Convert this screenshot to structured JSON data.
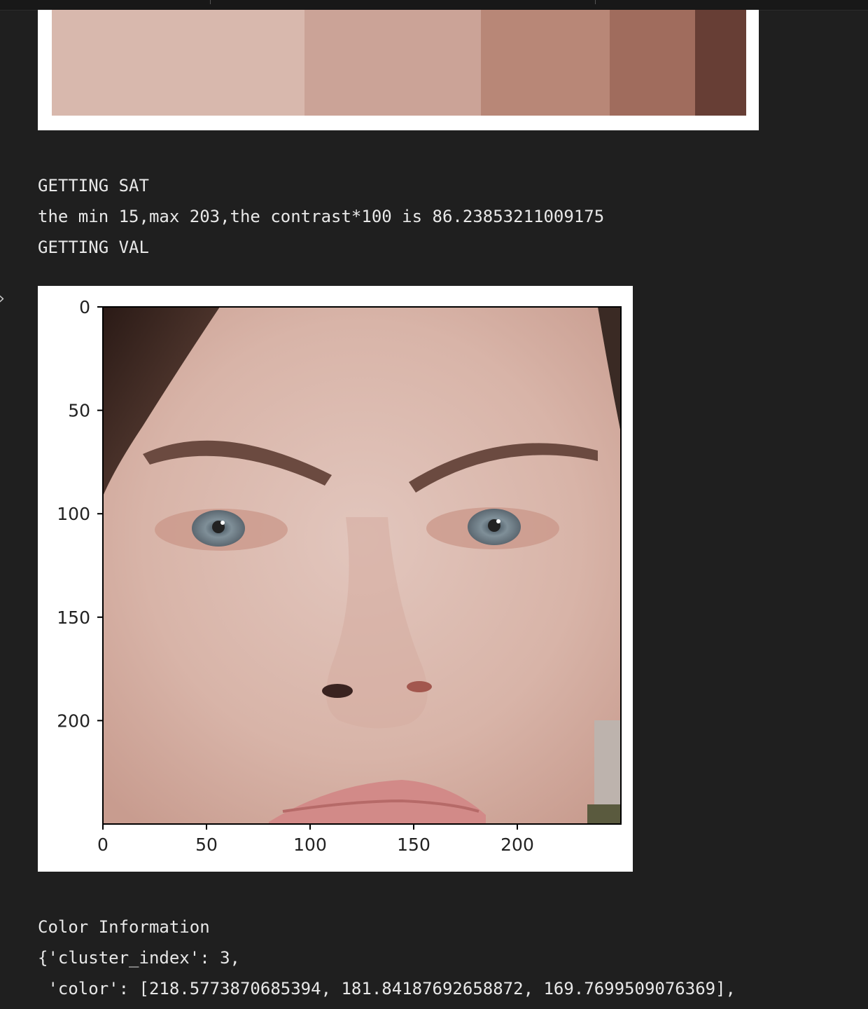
{
  "output": {
    "line_sat_header": "GETTING SAT",
    "line_contrast": "the min 15,max 203,the contrast*100 is 86.23853211009175",
    "line_val_header": "GETTING VAL",
    "color_info_header": "Color Information",
    "color_info_line1": "{'cluster_index': 3,",
    "color_info_line2": " 'color': [218.5773870685394, 181.84187692658872, 169.7699509076369],"
  },
  "palette": {
    "swatches": [
      {
        "color": "#d8b8ad",
        "fraction": 0.364
      },
      {
        "color": "#cba397",
        "fraction": 0.254
      },
      {
        "color": "#b88777",
        "fraction": 0.185
      },
      {
        "color": "#a06c5d",
        "fraction": 0.123
      },
      {
        "color": "#673e35",
        "fraction": 0.074
      }
    ]
  },
  "image_plot": {
    "x_ticks": [
      "0",
      "50",
      "100",
      "150",
      "200"
    ],
    "y_ticks": [
      "0",
      "50",
      "100",
      "150",
      "200"
    ],
    "x_tick_values": [
      0,
      50,
      100,
      150,
      200
    ],
    "y_tick_values": [
      0,
      50,
      100,
      150,
      200
    ],
    "extent": [
      250,
      250
    ]
  },
  "ui": {
    "cell_marker_icon": "chevron-right-icon"
  }
}
